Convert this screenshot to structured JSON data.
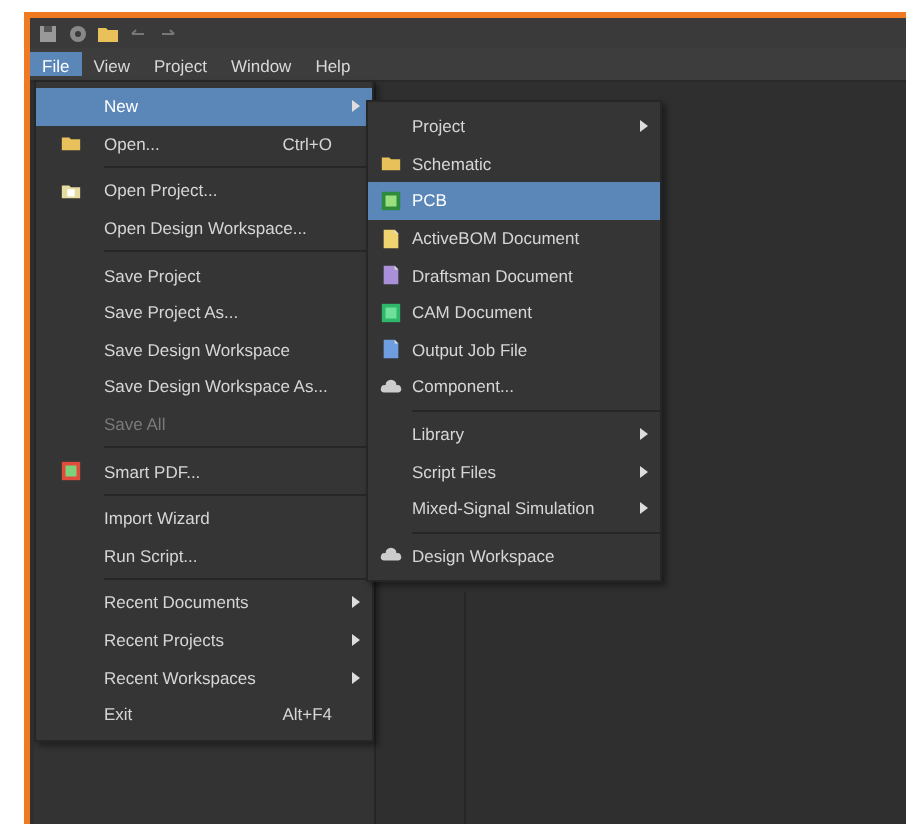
{
  "menubar": [
    {
      "label": "File",
      "selected": true
    },
    {
      "label": "View",
      "selected": false
    },
    {
      "label": "Project",
      "selected": false
    },
    {
      "label": "Window",
      "selected": false
    },
    {
      "label": "Help",
      "selected": false
    }
  ],
  "file_menu": [
    {
      "kind": "item",
      "label": "New",
      "submenu": true,
      "selected": true,
      "disabled": false
    },
    {
      "kind": "item",
      "label": "Open...",
      "shortcut": "Ctrl+O",
      "submenu": false,
      "selected": false,
      "disabled": false
    },
    {
      "kind": "separator"
    },
    {
      "kind": "item",
      "label": "Open Project...",
      "submenu": false,
      "selected": false,
      "disabled": false
    },
    {
      "kind": "item",
      "label": "Open Design Workspace...",
      "submenu": false,
      "selected": false,
      "disabled": false
    },
    {
      "kind": "separator"
    },
    {
      "kind": "item",
      "label": "Save Project",
      "submenu": false,
      "selected": false,
      "disabled": false
    },
    {
      "kind": "item",
      "label": "Save Project As...",
      "submenu": false,
      "selected": false,
      "disabled": false
    },
    {
      "kind": "item",
      "label": "Save Design Workspace",
      "submenu": false,
      "selected": false,
      "disabled": false
    },
    {
      "kind": "item",
      "label": "Save Design Workspace As...",
      "submenu": false,
      "selected": false,
      "disabled": false
    },
    {
      "kind": "item",
      "label": "Save All",
      "submenu": false,
      "selected": false,
      "disabled": true
    },
    {
      "kind": "separator"
    },
    {
      "kind": "item",
      "label": "Smart PDF...",
      "submenu": false,
      "selected": false,
      "disabled": false
    },
    {
      "kind": "separator"
    },
    {
      "kind": "item",
      "label": "Import Wizard",
      "submenu": false,
      "selected": false,
      "disabled": false
    },
    {
      "kind": "item",
      "label": "Run Script...",
      "submenu": false,
      "selected": false,
      "disabled": false
    },
    {
      "kind": "separator"
    },
    {
      "kind": "item",
      "label": "Recent Documents",
      "submenu": true,
      "selected": false,
      "disabled": false
    },
    {
      "kind": "item",
      "label": "Recent Projects",
      "submenu": true,
      "selected": false,
      "disabled": false
    },
    {
      "kind": "item",
      "label": "Recent Workspaces",
      "submenu": true,
      "selected": false,
      "disabled": false
    },
    {
      "kind": "item",
      "label": "Exit",
      "shortcut": "Alt+F4",
      "submenu": false,
      "selected": false,
      "disabled": false
    }
  ],
  "new_submenu": [
    {
      "kind": "item",
      "label": "Project",
      "submenu": true,
      "selected": false
    },
    {
      "kind": "item",
      "label": "Schematic",
      "submenu": false,
      "selected": false
    },
    {
      "kind": "item",
      "label": "PCB",
      "submenu": false,
      "selected": true
    },
    {
      "kind": "item",
      "label": "ActiveBOM Document",
      "submenu": false,
      "selected": false
    },
    {
      "kind": "item",
      "label": "Draftsman Document",
      "submenu": false,
      "selected": false
    },
    {
      "kind": "item",
      "label": "CAM Document",
      "submenu": false,
      "selected": false
    },
    {
      "kind": "item",
      "label": "Output Job File",
      "submenu": false,
      "selected": false
    },
    {
      "kind": "item",
      "label": "Component...",
      "submenu": false,
      "selected": false
    },
    {
      "kind": "separator"
    },
    {
      "kind": "item",
      "label": "Library",
      "submenu": true,
      "selected": false
    },
    {
      "kind": "item",
      "label": "Script Files",
      "submenu": true,
      "selected": false
    },
    {
      "kind": "item",
      "label": "Mixed-Signal Simulation",
      "submenu": true,
      "selected": false
    },
    {
      "kind": "separator"
    },
    {
      "kind": "item",
      "label": "Design Workspace",
      "submenu": false,
      "selected": false
    }
  ]
}
